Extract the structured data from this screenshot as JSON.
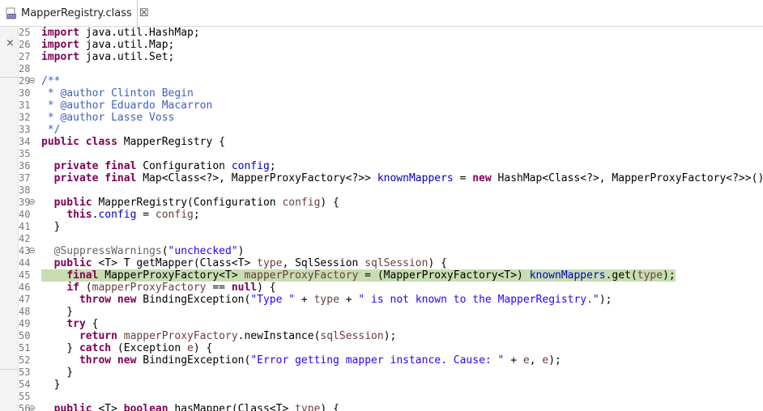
{
  "tab": {
    "title": "MapperRegistry.class",
    "close": "☒",
    "icon": "class-file-icon"
  },
  "left_panel": {
    "close": "×"
  },
  "colors": {
    "keyword": "#7f0055",
    "field": "#0000c0",
    "string": "#2a00ff",
    "javadoc": "#3f5fbf",
    "annotation": "#646464",
    "local_variable": "#6a3e3e",
    "highlight": "#c8ddb1"
  },
  "lines": [
    {
      "num": "25",
      "fold": false,
      "hl": false,
      "tokens": [
        [
          "kw",
          "import"
        ],
        [
          "txt",
          " java.util.HashMap;"
        ]
      ]
    },
    {
      "num": "26",
      "fold": false,
      "hl": false,
      "tokens": [
        [
          "kw",
          "import"
        ],
        [
          "txt",
          " java.util.Map;"
        ]
      ]
    },
    {
      "num": "27",
      "fold": false,
      "hl": false,
      "tokens": [
        [
          "kw",
          "import"
        ],
        [
          "txt",
          " java.util.Set;"
        ]
      ]
    },
    {
      "num": "28",
      "fold": false,
      "hl": false,
      "tokens": []
    },
    {
      "num": "29",
      "fold": true,
      "hl": false,
      "tokens": [
        [
          "cmt",
          "/**"
        ]
      ]
    },
    {
      "num": "30",
      "fold": false,
      "hl": false,
      "tokens": [
        [
          "cmt",
          " * @author Clinton Begin"
        ]
      ]
    },
    {
      "num": "31",
      "fold": false,
      "hl": false,
      "tokens": [
        [
          "cmt",
          " * @author Eduardo Macarron"
        ]
      ]
    },
    {
      "num": "32",
      "fold": false,
      "hl": false,
      "tokens": [
        [
          "cmt",
          " * @author Lasse Voss"
        ]
      ]
    },
    {
      "num": "33",
      "fold": false,
      "hl": false,
      "tokens": [
        [
          "cmt",
          " */"
        ]
      ]
    },
    {
      "num": "34",
      "fold": false,
      "hl": false,
      "tokens": [
        [
          "kw",
          "public class"
        ],
        [
          "txt",
          " MapperRegistry {"
        ]
      ]
    },
    {
      "num": "35",
      "fold": false,
      "hl": false,
      "tokens": []
    },
    {
      "num": "36",
      "fold": false,
      "hl": false,
      "tokens": [
        [
          "txt",
          "  "
        ],
        [
          "kw",
          "private final"
        ],
        [
          "txt",
          " Configuration "
        ],
        [
          "fld",
          "config"
        ],
        [
          "txt",
          ";"
        ]
      ]
    },
    {
      "num": "37",
      "fold": false,
      "hl": false,
      "tokens": [
        [
          "txt",
          "  "
        ],
        [
          "kw",
          "private final"
        ],
        [
          "txt",
          " Map<Class<?>, MapperProxyFactory<?>> "
        ],
        [
          "fld",
          "knownMappers"
        ],
        [
          "txt",
          " = "
        ],
        [
          "kw",
          "new"
        ],
        [
          "txt",
          " HashMap<Class<?>, MapperProxyFactory<?>>();"
        ]
      ]
    },
    {
      "num": "38",
      "fold": false,
      "hl": false,
      "tokens": []
    },
    {
      "num": "39",
      "fold": true,
      "hl": false,
      "tokens": [
        [
          "txt",
          "  "
        ],
        [
          "kw",
          "public"
        ],
        [
          "txt",
          " MapperRegistry(Configuration "
        ],
        [
          "lvar",
          "config"
        ],
        [
          "txt",
          ") {"
        ]
      ]
    },
    {
      "num": "40",
      "fold": false,
      "hl": false,
      "tokens": [
        [
          "txt",
          "    "
        ],
        [
          "kw",
          "this"
        ],
        [
          "txt",
          "."
        ],
        [
          "fld",
          "config"
        ],
        [
          "txt",
          " = "
        ],
        [
          "lvar",
          "config"
        ],
        [
          "txt",
          ";"
        ]
      ]
    },
    {
      "num": "41",
      "fold": false,
      "hl": false,
      "tokens": [
        [
          "txt",
          "  }"
        ]
      ]
    },
    {
      "num": "42",
      "fold": false,
      "hl": false,
      "tokens": []
    },
    {
      "num": "43",
      "fold": true,
      "hl": false,
      "tokens": [
        [
          "txt",
          "  "
        ],
        [
          "ann",
          "@SuppressWarnings"
        ],
        [
          "txt",
          "("
        ],
        [
          "str",
          "\"unchecked\""
        ],
        [
          "txt",
          ")"
        ]
      ]
    },
    {
      "num": "44",
      "fold": false,
      "hl": false,
      "tokens": [
        [
          "txt",
          "  "
        ],
        [
          "kw",
          "public"
        ],
        [
          "txt",
          " <T> T getMapper(Class<T> "
        ],
        [
          "lvar",
          "type"
        ],
        [
          "txt",
          ", SqlSession "
        ],
        [
          "lvar",
          "sqlSession"
        ],
        [
          "txt",
          ") {"
        ]
      ]
    },
    {
      "num": "45",
      "fold": false,
      "hl": true,
      "tokens": [
        [
          "txt",
          "    "
        ],
        [
          "kw",
          "final"
        ],
        [
          "txt",
          " MapperProxyFactory<T> "
        ],
        [
          "lvar",
          "mapperProxyFactory"
        ],
        [
          "txt",
          " = (MapperProxyFactory<T>) "
        ],
        [
          "fld",
          "knownMappers"
        ],
        [
          "txt",
          ".get("
        ],
        [
          "lvar",
          "type"
        ],
        [
          "txt",
          ");"
        ]
      ]
    },
    {
      "num": "46",
      "fold": false,
      "hl": false,
      "tokens": [
        [
          "txt",
          "    "
        ],
        [
          "kw",
          "if"
        ],
        [
          "txt",
          " ("
        ],
        [
          "lvar",
          "mapperProxyFactory"
        ],
        [
          "txt",
          " == "
        ],
        [
          "kw",
          "null"
        ],
        [
          "txt",
          ") {"
        ]
      ]
    },
    {
      "num": "47",
      "fold": false,
      "hl": false,
      "tokens": [
        [
          "txt",
          "      "
        ],
        [
          "kw",
          "throw new"
        ],
        [
          "txt",
          " BindingException("
        ],
        [
          "str",
          "\"Type \""
        ],
        [
          "txt",
          " + "
        ],
        [
          "lvar",
          "type"
        ],
        [
          "txt",
          " + "
        ],
        [
          "str",
          "\" is not known to the MapperRegistry.\""
        ],
        [
          "txt",
          ");"
        ]
      ]
    },
    {
      "num": "48",
      "fold": false,
      "hl": false,
      "tokens": [
        [
          "txt",
          "    }"
        ]
      ]
    },
    {
      "num": "49",
      "fold": false,
      "hl": false,
      "tokens": [
        [
          "txt",
          "    "
        ],
        [
          "kw",
          "try"
        ],
        [
          "txt",
          " {"
        ]
      ]
    },
    {
      "num": "50",
      "fold": false,
      "hl": false,
      "tokens": [
        [
          "txt",
          "      "
        ],
        [
          "kw",
          "return"
        ],
        [
          "txt",
          " "
        ],
        [
          "lvar",
          "mapperProxyFactory"
        ],
        [
          "txt",
          ".newInstance("
        ],
        [
          "lvar",
          "sqlSession"
        ],
        [
          "txt",
          ");"
        ]
      ]
    },
    {
      "num": "51",
      "fold": false,
      "hl": false,
      "tokens": [
        [
          "txt",
          "    } "
        ],
        [
          "kw",
          "catch"
        ],
        [
          "txt",
          " (Exception "
        ],
        [
          "lvar",
          "e"
        ],
        [
          "txt",
          ") {"
        ]
      ]
    },
    {
      "num": "52",
      "fold": false,
      "hl": false,
      "tokens": [
        [
          "txt",
          "      "
        ],
        [
          "kw",
          "throw new"
        ],
        [
          "txt",
          " BindingException("
        ],
        [
          "str",
          "\"Error getting mapper instance. Cause: \""
        ],
        [
          "txt",
          " + "
        ],
        [
          "lvar",
          "e"
        ],
        [
          "txt",
          ", "
        ],
        [
          "lvar",
          "e"
        ],
        [
          "txt",
          ");"
        ]
      ]
    },
    {
      "num": "53",
      "fold": false,
      "hl": false,
      "tokens": [
        [
          "txt",
          "    }"
        ]
      ]
    },
    {
      "num": "54",
      "fold": false,
      "hl": false,
      "tokens": [
        [
          "txt",
          "  }"
        ]
      ]
    },
    {
      "num": "55",
      "fold": false,
      "hl": false,
      "tokens": []
    },
    {
      "num": "56",
      "fold": true,
      "hl": false,
      "tokens": [
        [
          "txt",
          "  "
        ],
        [
          "kw",
          "public"
        ],
        [
          "txt",
          " <T> "
        ],
        [
          "kw",
          "boolean"
        ],
        [
          "txt",
          " hasMapper(Class<T> "
        ],
        [
          "lvar",
          "type"
        ],
        [
          "txt",
          ") {"
        ]
      ]
    }
  ]
}
